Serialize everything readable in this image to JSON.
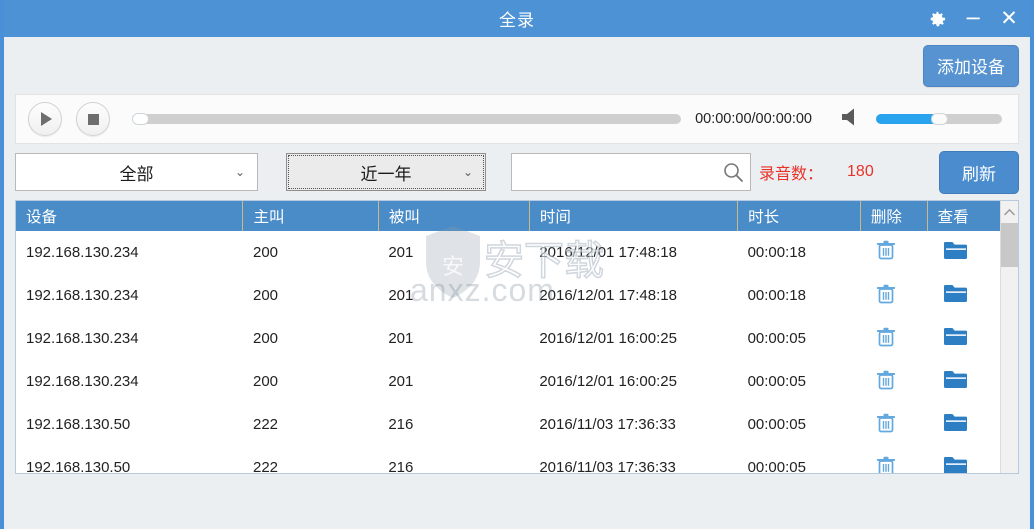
{
  "window": {
    "title": "全录",
    "controls": [
      {
        "name": "settings-gear",
        "icon": "gear-icon"
      },
      {
        "name": "minimize",
        "icon": "minimize-icon",
        "glyph": "−"
      },
      {
        "name": "close",
        "icon": "close-icon",
        "glyph": "✕"
      }
    ]
  },
  "toolbar": {
    "add_device_label": "添加设备"
  },
  "player": {
    "play_icon": "play-icon",
    "stop_icon": "stop-icon",
    "progress_percent": 0,
    "time_label": "00:00:00/00:00:00",
    "speaker_icon": "speaker-icon",
    "volume_percent": 50
  },
  "filters": {
    "device_select": {
      "value": "全部",
      "chevron": "chevron-down-icon"
    },
    "range_select": {
      "value": "近一年",
      "chevron": "chevron-down-icon"
    },
    "search": {
      "value": "",
      "placeholder": "",
      "icon": "search-icon"
    },
    "record_count_label": "录音数：",
    "record_count_value": "180",
    "record_count_color": "#e8332a",
    "refresh_label": "刷新"
  },
  "table": {
    "columns": [
      "设备",
      "主叫",
      "被叫",
      "时间",
      "时长",
      "删除",
      "查看"
    ],
    "rows": [
      {
        "device": "192.168.130.234",
        "caller": "200",
        "callee": "201",
        "time": "2016/12/01 17:48:18",
        "duration": "00:00:18",
        "delete_icon": "trash-icon",
        "view_icon": "folder-icon"
      },
      {
        "device": "192.168.130.234",
        "caller": "200",
        "callee": "201",
        "time": "2016/12/01 17:48:18",
        "duration": "00:00:18",
        "delete_icon": "trash-icon",
        "view_icon": "folder-icon"
      },
      {
        "device": "192.168.130.234",
        "caller": "200",
        "callee": "201",
        "time": "2016/12/01 16:00:25",
        "duration": "00:00:05",
        "delete_icon": "trash-icon",
        "view_icon": "folder-icon"
      },
      {
        "device": "192.168.130.234",
        "caller": "200",
        "callee": "201",
        "time": "2016/12/01 16:00:25",
        "duration": "00:00:05",
        "delete_icon": "trash-icon",
        "view_icon": "folder-icon"
      },
      {
        "device": "192.168.130.50",
        "caller": "222",
        "callee": "216",
        "time": "2016/11/03 17:36:33",
        "duration": "00:00:05",
        "delete_icon": "trash-icon",
        "view_icon": "folder-icon"
      },
      {
        "device": "192.168.130.50",
        "caller": "222",
        "callee": "216",
        "time": "2016/11/03 17:36:33",
        "duration": "00:00:05",
        "delete_icon": "trash-icon",
        "view_icon": "folder-icon"
      }
    ],
    "scrollbar": {
      "up_arrow": "chevron-up-icon"
    }
  },
  "watermark": {
    "text": "anxz.com",
    "cn_text": "安下载",
    "shield_glyph": "安"
  },
  "colors": {
    "titlebar": "#4c92d4",
    "accent": "#4a8ccd",
    "header": "#4a8cc8",
    "alert": "#e8332a",
    "volume": "#2aa3ef"
  }
}
